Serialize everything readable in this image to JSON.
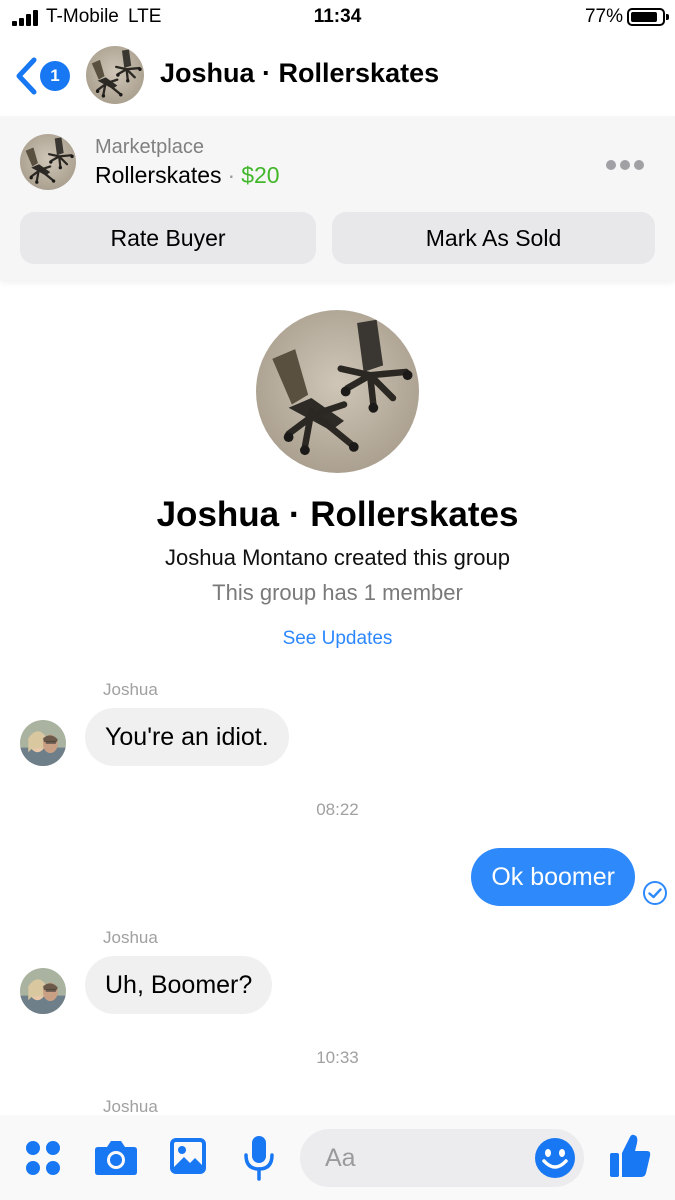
{
  "status_bar": {
    "carrier": "T-Mobile",
    "network": "LTE",
    "time": "11:34",
    "battery_pct": "77%",
    "battery_level": 0.77
  },
  "header": {
    "back_badge": "1",
    "title": "Joshua · Rollerskates"
  },
  "marketplace": {
    "kicker": "Marketplace",
    "item_name": "Rollerskates",
    "separator": "·",
    "price": "$20",
    "rate_buyer_label": "Rate Buyer",
    "mark_sold_label": "Mark As Sold"
  },
  "group": {
    "name": "Joshua · Rollerskates",
    "created_by": "Joshua Montano created this group",
    "members": "This group has 1 member",
    "see_updates": "See Updates"
  },
  "messages": [
    {
      "sender": "Joshua",
      "text": "You're an idiot.",
      "direction": "incoming"
    },
    {
      "timestamp": "08:22"
    },
    {
      "text": "Ok boomer",
      "direction": "outgoing"
    },
    {
      "sender": "Joshua",
      "text": "Uh, Boomer?",
      "direction": "incoming"
    },
    {
      "timestamp": "10:33"
    },
    {
      "sender": "Joshua"
    }
  ],
  "composer": {
    "placeholder": "Aa",
    "icons": [
      "apps-icon",
      "camera-icon",
      "photo-icon",
      "microphone-icon",
      "emoji-icon",
      "thumbs-up-icon"
    ]
  },
  "colors": {
    "accent": "#1877f2",
    "outgoing_bubble": "#2e89fb",
    "incoming_bubble": "#f0f0f0",
    "price": "#42b72a"
  }
}
